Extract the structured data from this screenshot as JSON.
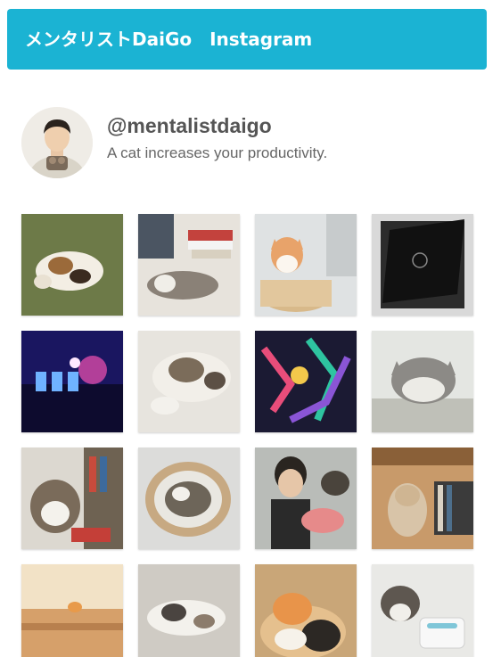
{
  "widget": {
    "title": "メンタリストDaiGo　Instagram"
  },
  "profile": {
    "handle": "@mentalistdaigo",
    "bio": "A cat increases your productivity.",
    "avatar_icon": "profile-photo-icon"
  },
  "photos": [
    {
      "label": "cat-lying-on-green-rug"
    },
    {
      "label": "cat-near-bookshelf"
    },
    {
      "label": "cat-in-round-box"
    },
    {
      "label": "black-cards-fanned"
    },
    {
      "label": "concert-stage-lights"
    },
    {
      "label": "cat-lying-on-back"
    },
    {
      "label": "colorful-abstract-lights"
    },
    {
      "label": "cat-face-closeup"
    },
    {
      "label": "cat-by-bookshelf"
    },
    {
      "label": "cat-curled-in-round-bed"
    },
    {
      "label": "person-with-cat-and-cake"
    },
    {
      "label": "cat-sitting-by-books"
    },
    {
      "label": "cat-peeking-in-box"
    },
    {
      "label": "cat-on-floor"
    },
    {
      "label": "two-cats-cuddling"
    },
    {
      "label": "cat-with-white-device"
    }
  ],
  "colors": {
    "header_bg": "#1bb3d3",
    "header_text": "#ffffff",
    "handle_text": "#555555",
    "bio_text": "#666666"
  }
}
